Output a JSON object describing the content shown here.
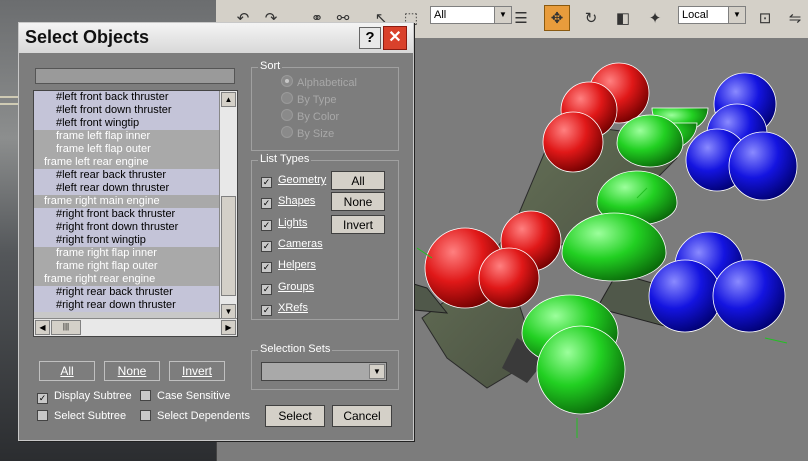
{
  "dialog": {
    "title": "Select Objects",
    "help_glyph": "?",
    "close_glyph": "✕",
    "filter_value": "",
    "list_items": [
      {
        "label": "#left front back thruster",
        "indent": 2,
        "selected": true
      },
      {
        "label": "#left front down thruster",
        "indent": 2,
        "selected": true
      },
      {
        "label": "#left front wingtip",
        "indent": 2,
        "selected": true
      },
      {
        "label": "frame left flap inner",
        "indent": 2,
        "selected": false
      },
      {
        "label": "frame left flap outer",
        "indent": 2,
        "selected": false
      },
      {
        "label": "frame left rear engine",
        "indent": 1,
        "selected": false
      },
      {
        "label": "#left rear back thruster",
        "indent": 2,
        "selected": true
      },
      {
        "label": "#left rear down thruster",
        "indent": 2,
        "selected": true
      },
      {
        "label": "frame right main engine",
        "indent": 1,
        "selected": false
      },
      {
        "label": "#right front back thruster",
        "indent": 2,
        "selected": true
      },
      {
        "label": "#right front down thruster",
        "indent": 2,
        "selected": true
      },
      {
        "label": "#right front wingtip",
        "indent": 2,
        "selected": true
      },
      {
        "label": "frame right flap inner",
        "indent": 2,
        "selected": false
      },
      {
        "label": "frame right flap outer",
        "indent": 2,
        "selected": false
      },
      {
        "label": "frame right rear engine",
        "indent": 1,
        "selected": false
      },
      {
        "label": "#right rear back thruster",
        "indent": 2,
        "selected": true
      },
      {
        "label": "#right rear down thruster",
        "indent": 2,
        "selected": true
      }
    ],
    "list_buttons": {
      "all": "All",
      "none": "None",
      "invert": "Invert"
    },
    "options": {
      "display_subtree": {
        "label": "Display Subtree",
        "checked": true
      },
      "case_sensitive": {
        "label": "Case Sensitive",
        "checked": false
      },
      "select_subtree": {
        "label": "Select Subtree",
        "checked": false
      },
      "select_dependents": {
        "label": "Select Dependents",
        "checked": false
      }
    },
    "sort": {
      "title": "Sort",
      "options": [
        "Alphabetical",
        "By Type",
        "By Color",
        "By Size"
      ],
      "selected_index": 0
    },
    "list_types": {
      "title": "List Types",
      "items": [
        {
          "label": "Geometry",
          "checked": true
        },
        {
          "label": "Shapes",
          "checked": true
        },
        {
          "label": "Lights",
          "checked": true
        },
        {
          "label": "Cameras",
          "checked": true
        },
        {
          "label": "Helpers",
          "checked": true
        },
        {
          "label": "Groups",
          "checked": true
        },
        {
          "label": "XRefs",
          "checked": true
        }
      ],
      "buttons": {
        "all": "All",
        "none": "None",
        "invert": "Invert"
      }
    },
    "selection_sets": {
      "title": "Selection Sets",
      "value": ""
    },
    "actions": {
      "select": "Select",
      "cancel": "Cancel"
    }
  },
  "toolbar": {
    "filter_combo": "All",
    "coord_combo": "Local"
  },
  "colors": {
    "dialog_bg": "#7d7d7d",
    "selected_row": "#c4c4d8",
    "unselected_row": "#a9a9a9",
    "active_tool": "#e89c3c",
    "close_button": "#d9412b"
  }
}
